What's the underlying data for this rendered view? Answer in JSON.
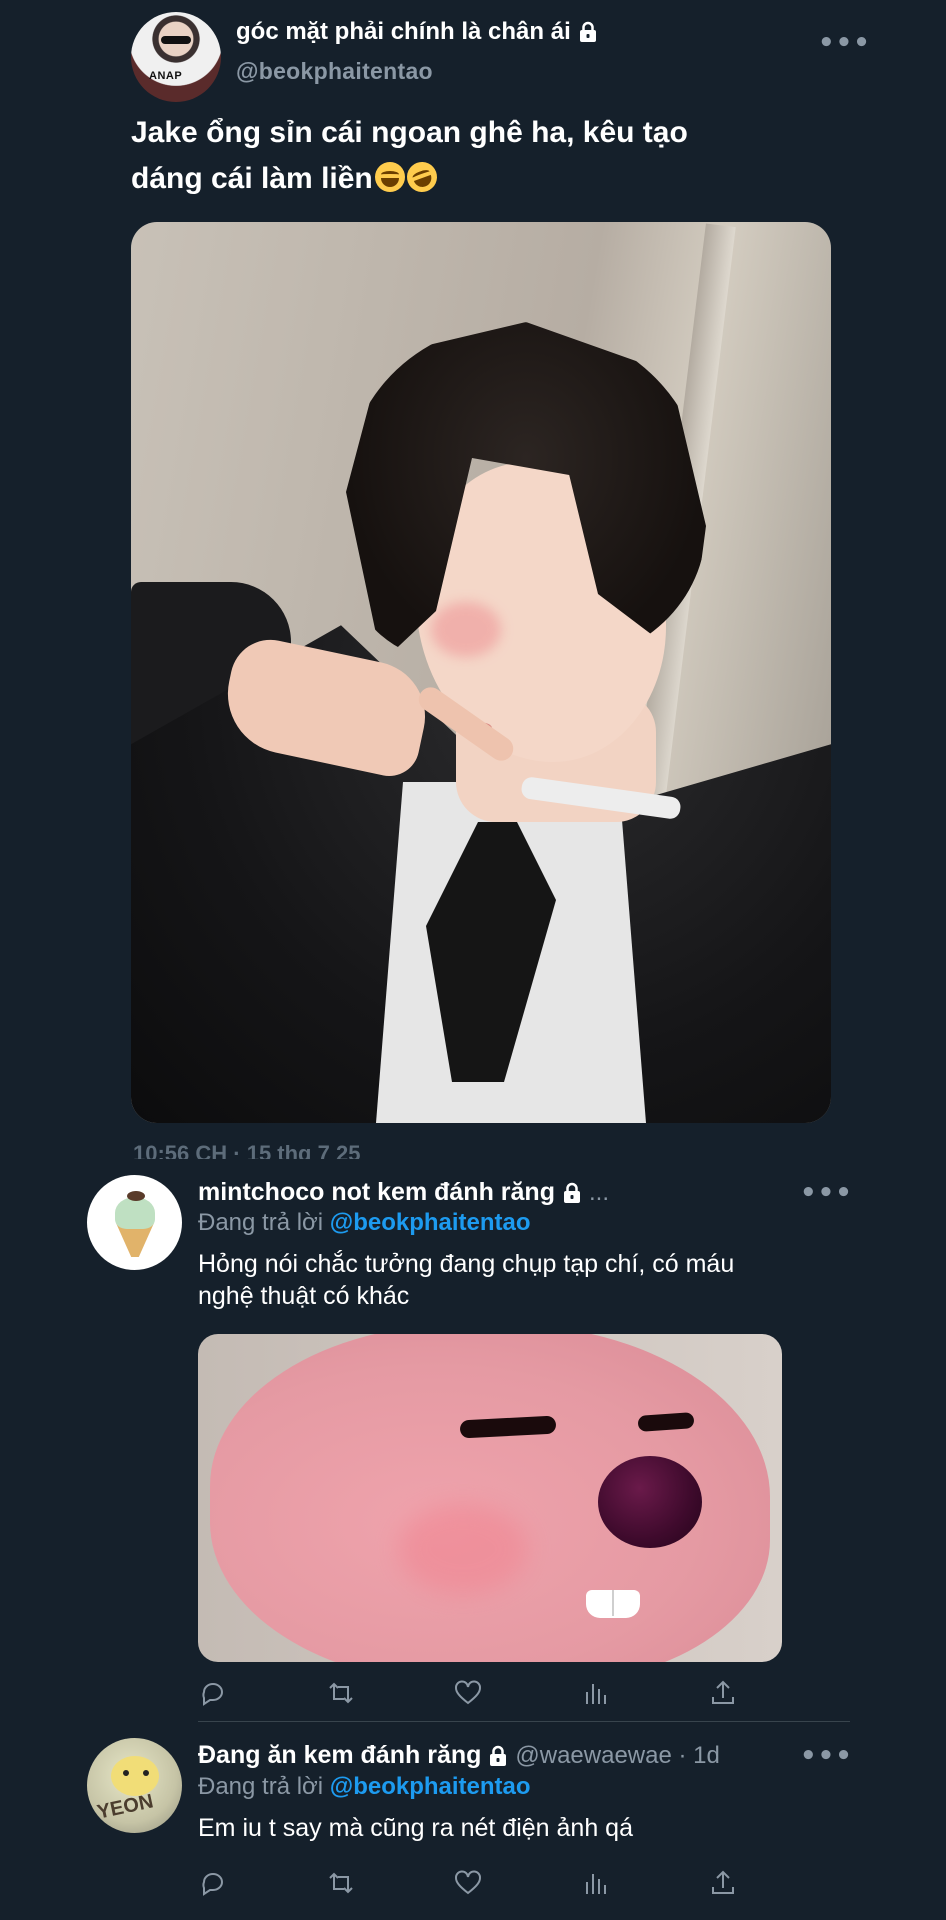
{
  "tweet": {
    "display_name": "góc mặt phải chính là chân ái",
    "handle": "@beokphaitentao",
    "text_line1": "Jake ổng sỉn cái ngoan ghê ha, kêu tạo",
    "text_line2": "dáng cái làm liền",
    "timestamp": "10:56 CH · 15 thg 7 25",
    "more_label": "•••"
  },
  "replies": [
    {
      "display_name": "mintchoco not kem đánh răng",
      "handle_suffix": "...",
      "reply_prefix": "Đang trả lời",
      "reply_to": "@beokphaitentao",
      "text_line1": "Hỏng nói chắc tưởng đang chụp tạp chí, có máu",
      "text_line2": "nghệ thuật có khác",
      "more_label": "•••"
    },
    {
      "display_name": "Đang ăn kem đánh răng",
      "handle": "@waewaewae · 1d",
      "reply_prefix": "Đang trả lời",
      "reply_to": "@beokphaitentao",
      "text": "Em iu t say mà cũng ra nét điện ảnh qá",
      "more_label": "•••",
      "avatar_text": "YEON"
    }
  ],
  "avatar_text_main": "ANAP",
  "icons": [
    "lock-icon",
    "more-icon",
    "reply-icon",
    "retweet-icon",
    "like-icon",
    "views-icon",
    "share-icon"
  ],
  "colors": {
    "background": "#15202b",
    "secondary_text": "#8b98a5",
    "mention": "#1d9bf0"
  }
}
